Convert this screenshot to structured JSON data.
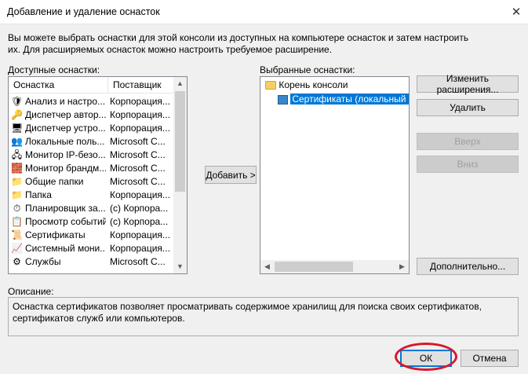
{
  "window": {
    "title": "Добавление и удаление оснасток"
  },
  "intro_text": "Вы можете выбрать оснастки для этой консоли из доступных на компьютере оснасток и затем настроить их. Для расширяемых оснасток можно настроить требуемое расширение.",
  "available": {
    "label": "Доступные оснастки:",
    "columns": [
      "Оснастка",
      "Поставщик"
    ],
    "items": [
      {
        "name": "Анализ и настро...",
        "vendor": "Корпорация...",
        "icon": "security-analysis-icon"
      },
      {
        "name": "Диспетчер автор...",
        "vendor": "Корпорация...",
        "icon": "authorization-manager-icon"
      },
      {
        "name": "Диспетчер устро...",
        "vendor": "Корпорация...",
        "icon": "device-manager-icon"
      },
      {
        "name": "Локальные поль...",
        "vendor": "Microsoft C...",
        "icon": "local-users-icon"
      },
      {
        "name": "Монитор IP-безо...",
        "vendor": "Microsoft C...",
        "icon": "ip-security-monitor-icon"
      },
      {
        "name": "Монитор брандм...",
        "vendor": "Microsoft C...",
        "icon": "firewall-monitor-icon"
      },
      {
        "name": "Общие папки",
        "vendor": "Microsoft C...",
        "icon": "shared-folders-icon"
      },
      {
        "name": "Папка",
        "vendor": "Корпорация...",
        "icon": "folder-icon"
      },
      {
        "name": "Планировщик за...",
        "vendor": "(с) Корпора...",
        "icon": "task-scheduler-icon"
      },
      {
        "name": "Просмотр событий",
        "vendor": "(с) Корпора...",
        "icon": "event-viewer-icon"
      },
      {
        "name": "Сертификаты",
        "vendor": "Корпорация...",
        "icon": "certificates-icon"
      },
      {
        "name": "Системный мони...",
        "vendor": "Корпорация...",
        "icon": "system-monitor-icon"
      },
      {
        "name": "Службы",
        "vendor": "Microsoft C...",
        "icon": "services-icon"
      }
    ]
  },
  "add_button": "Добавить >",
  "selected": {
    "label": "Выбранные оснастки:",
    "root": "Корень консоли",
    "child": "Сертификаты (локальный ко"
  },
  "buttons": {
    "edit_extensions": "Изменить расширения...",
    "remove": "Удалить",
    "up": "Вверх",
    "down": "Вниз",
    "advanced": "Дополнительно...",
    "ok": "ОК",
    "cancel": "Отмена"
  },
  "description": {
    "label": "Описание:",
    "text": "Оснастка сертификатов позволяет просматривать содержимое хранилищ для поиска своих сертификатов, сертификатов служб или компьютеров."
  },
  "colors": {
    "selection": "#0078d7",
    "highlight_ring": "#d7182a"
  }
}
